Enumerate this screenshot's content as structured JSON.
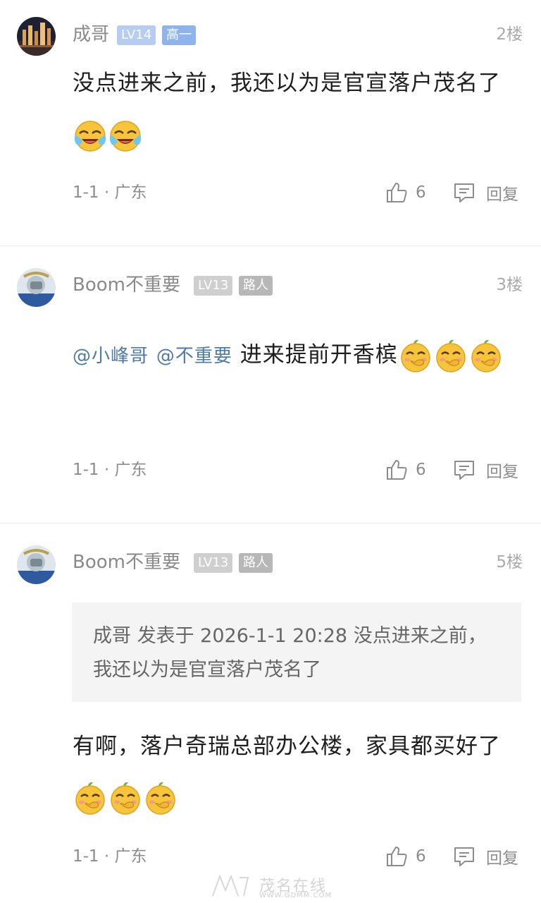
{
  "colors": {
    "text": "#1e1e1e",
    "muted": "#8c8c8c",
    "mention": "#4e7aa8",
    "level_badge_active": "#b6ccf0",
    "role_badge_active": "#8fb4ec",
    "level_badge_gray": "#cfcfcf",
    "role_badge_gray": "#b7b7b7",
    "quote_bg": "#f4f4f4"
  },
  "comments": [
    {
      "username": "成哥",
      "level": "LV14",
      "role": "高一",
      "floor": "2楼",
      "text": "没点进来之前，我还以为是官宣落户茂名了",
      "emojis": [
        "cry-laugh-emoji",
        "cry-laugh-emoji"
      ],
      "meta": "1-1 · 广东",
      "likes": "6",
      "reply_label": "回复"
    },
    {
      "username": "Boom不重要",
      "level": "LV13",
      "role": "路人",
      "floor": "3楼",
      "mentions": [
        "@小峰哥",
        "@不重要"
      ],
      "text": "进来提前开香槟",
      "emojis": [
        "snicker-emoji",
        "snicker-emoji",
        "snicker-emoji"
      ],
      "meta": "1-1 · 广东",
      "likes": "6",
      "reply_label": "回复"
    },
    {
      "username": "Boom不重要",
      "level": "LV13",
      "role": "路人",
      "floor": "5楼",
      "quote": "成哥 发表于 2026-1-1 20:28 没点进来之前，我还以为是官宣落户茂名了",
      "text": "有啊，落户奇瑞总部办公楼，家具都买好了",
      "emojis": [
        "snicker-emoji",
        "snicker-emoji",
        "snicker-emoji"
      ],
      "meta": "1-1 · 广东",
      "likes": "6",
      "reply_label": "回复"
    }
  ],
  "watermark": {
    "title": "茂名在线",
    "url": "WWW.GDMM.COM"
  }
}
